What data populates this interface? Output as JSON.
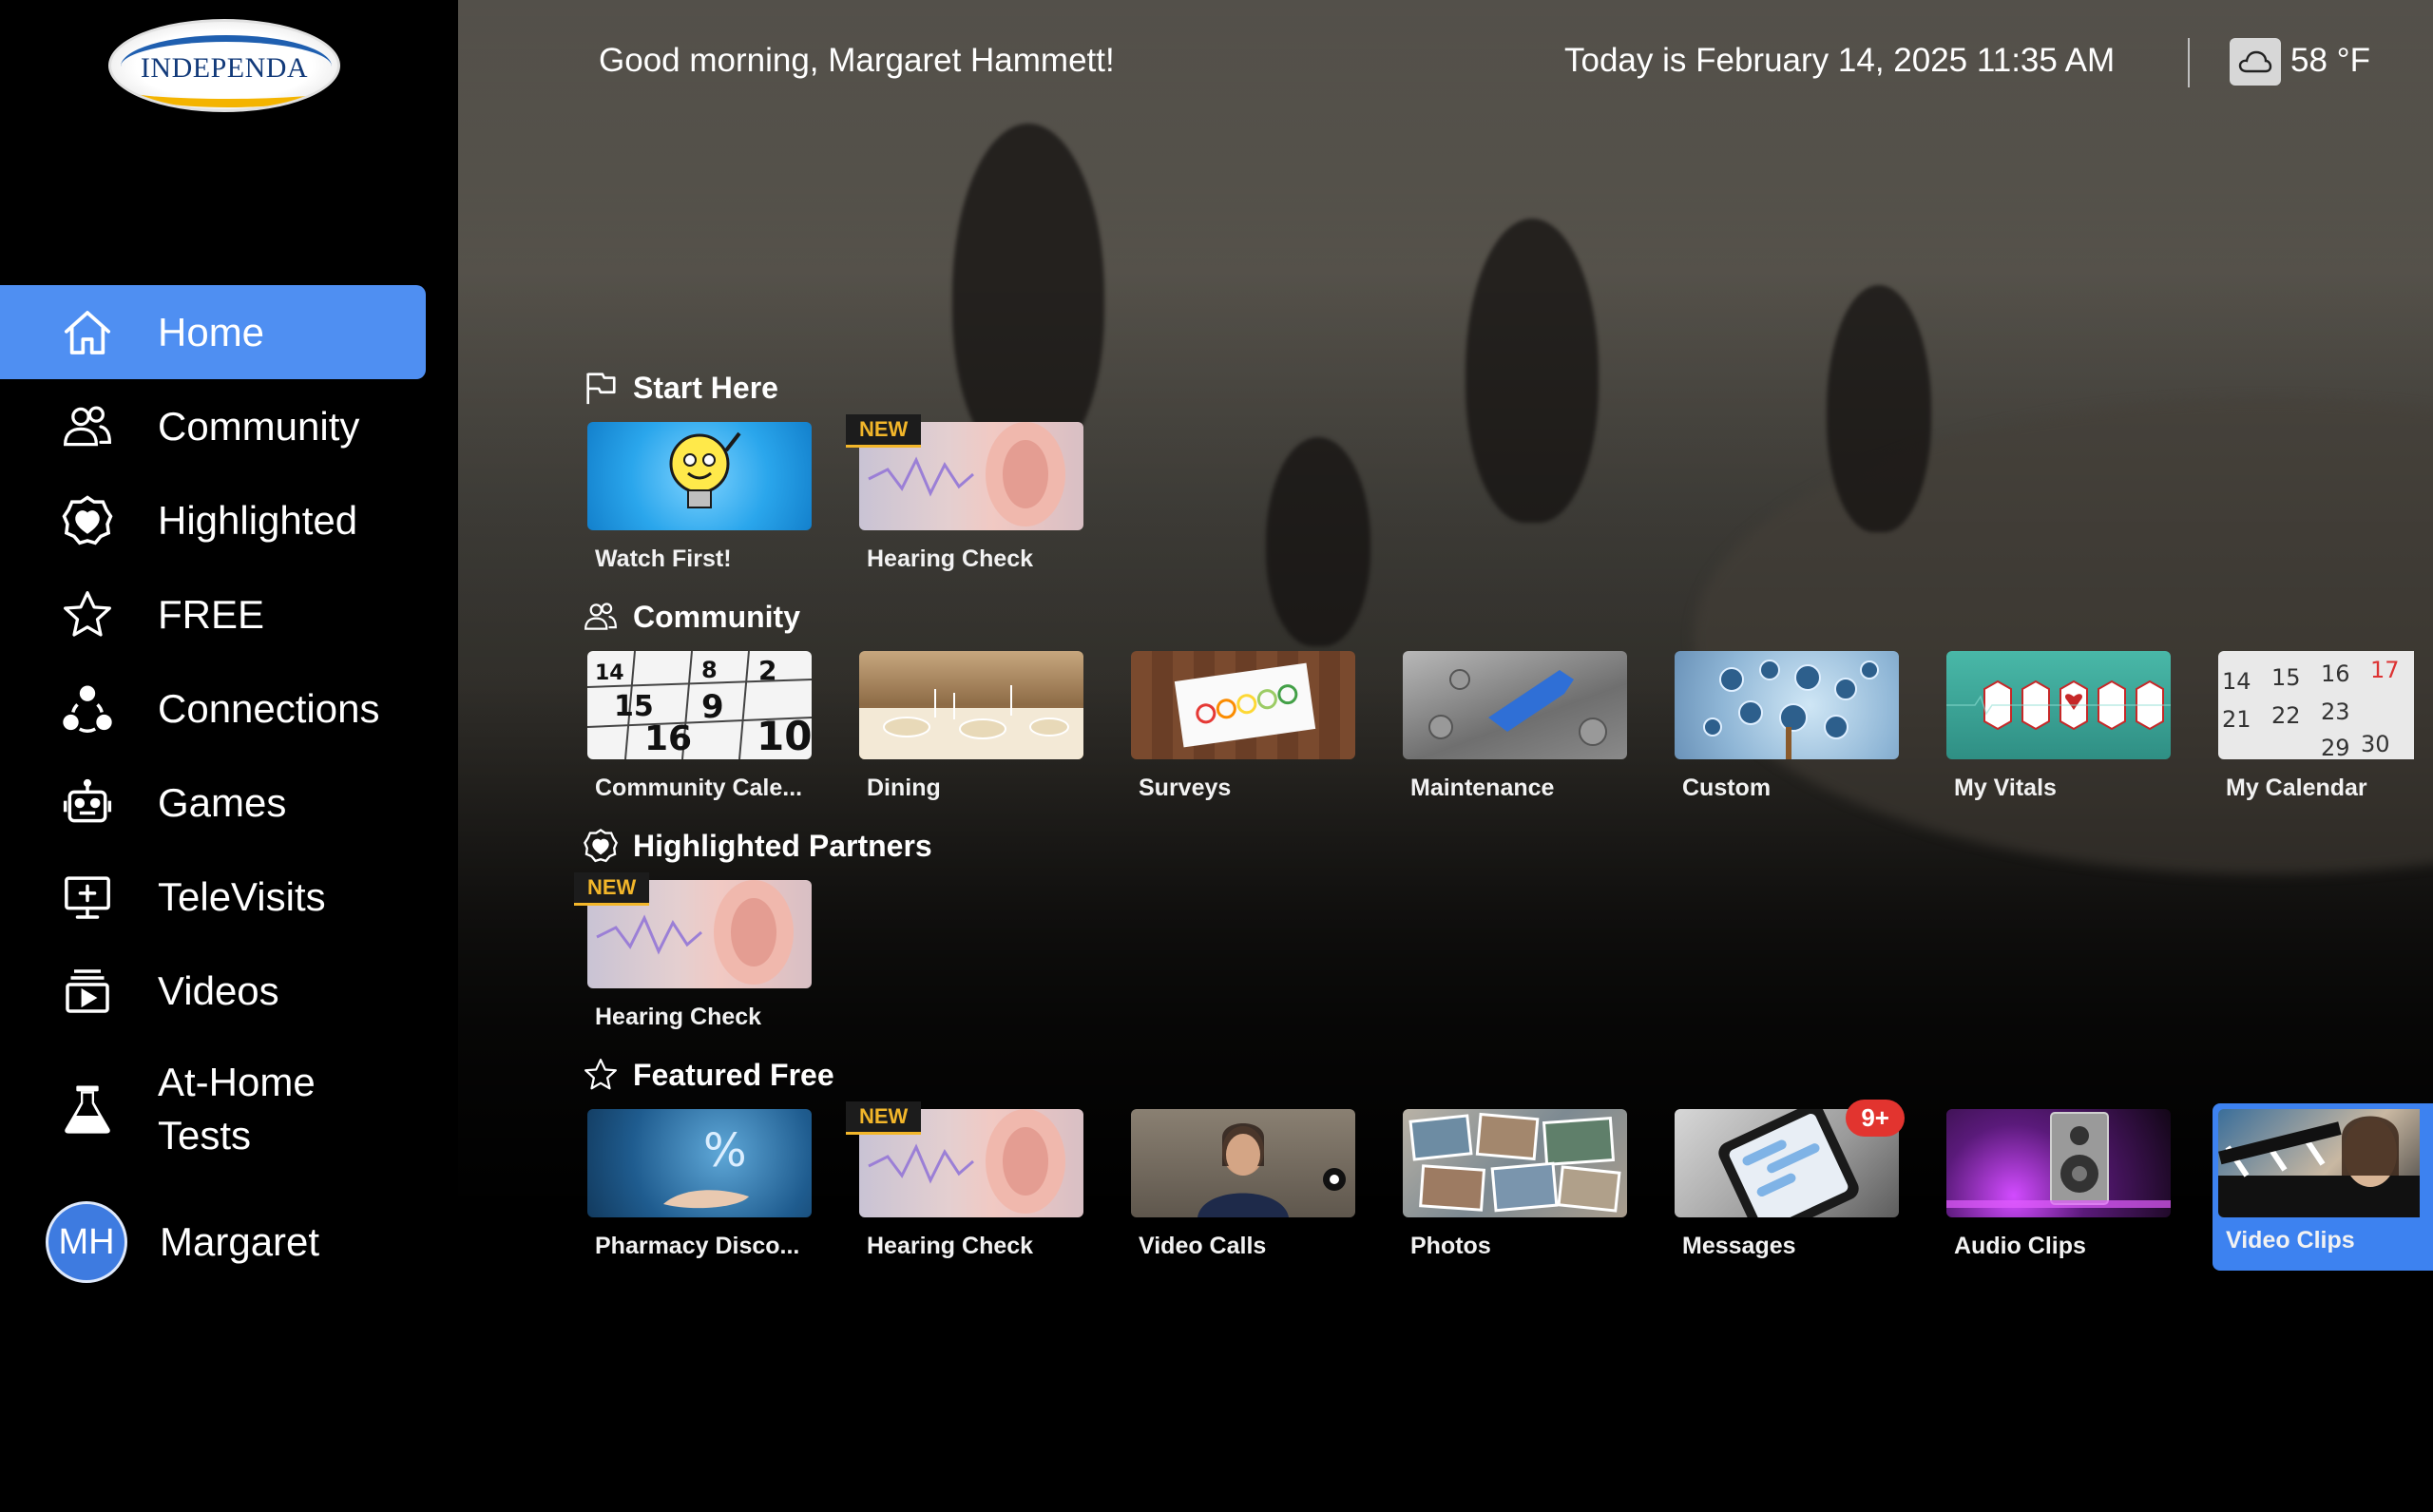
{
  "logo": {
    "text": "INDEPENDA"
  },
  "sidebar": {
    "items": [
      {
        "label": "Home",
        "icon": "home-icon",
        "active": true
      },
      {
        "label": "Community",
        "icon": "community-icon"
      },
      {
        "label": "Highlighted",
        "icon": "highlighted-icon"
      },
      {
        "label": "FREE",
        "icon": "star-icon"
      },
      {
        "label": "Connections",
        "icon": "connections-icon"
      },
      {
        "label": "Games",
        "icon": "games-icon"
      },
      {
        "label": "TeleVisits",
        "icon": "televisits-icon"
      },
      {
        "label": "Videos",
        "icon": "videos-icon"
      },
      {
        "label": "At-Home Tests",
        "icon": "flask-icon"
      }
    ],
    "user": {
      "initials": "MH",
      "name": "Margaret"
    }
  },
  "header": {
    "greeting": "Good morning, Margaret Hammett!",
    "date": "Today is February 14, 2025 11:35 AM",
    "weather_icon": "cloud-icon",
    "temperature": "58 °F"
  },
  "sections": {
    "start_here": {
      "title": "Start Here",
      "tiles": [
        {
          "label": "Watch First!"
        },
        {
          "label": "Hearing Check",
          "badge": "NEW"
        }
      ]
    },
    "community": {
      "title": "Community",
      "tiles": [
        {
          "label": "Community Cale..."
        },
        {
          "label": "Dining"
        },
        {
          "label": "Surveys"
        },
        {
          "label": "Maintenance"
        },
        {
          "label": "Custom"
        },
        {
          "label": "My Vitals"
        },
        {
          "label": "My Calendar"
        }
      ]
    },
    "highlighted": {
      "title": "Highlighted Partners",
      "tiles": [
        {
          "label": "Hearing Check",
          "badge": "NEW"
        }
      ]
    },
    "featured": {
      "title": "Featured Free",
      "tiles": [
        {
          "label": "Pharmacy Disco..."
        },
        {
          "label": "Hearing Check",
          "badge": "NEW"
        },
        {
          "label": "Video Calls"
        },
        {
          "label": "Photos"
        },
        {
          "label": "Messages",
          "count": "9+"
        },
        {
          "label": "Audio Clips"
        },
        {
          "label": "Video Clips",
          "selected": true
        }
      ]
    }
  },
  "calendar_numbers": [
    "14",
    "15",
    "16",
    "8",
    "9",
    "2",
    "10"
  ],
  "mycal_numbers": [
    "14",
    "15",
    "16",
    "17",
    "21",
    "22",
    "23",
    "29",
    "30"
  ],
  "colors": {
    "accent": "#4f8ff2",
    "new_badge": "#f2b62a",
    "count_badge": "#e2342f"
  }
}
